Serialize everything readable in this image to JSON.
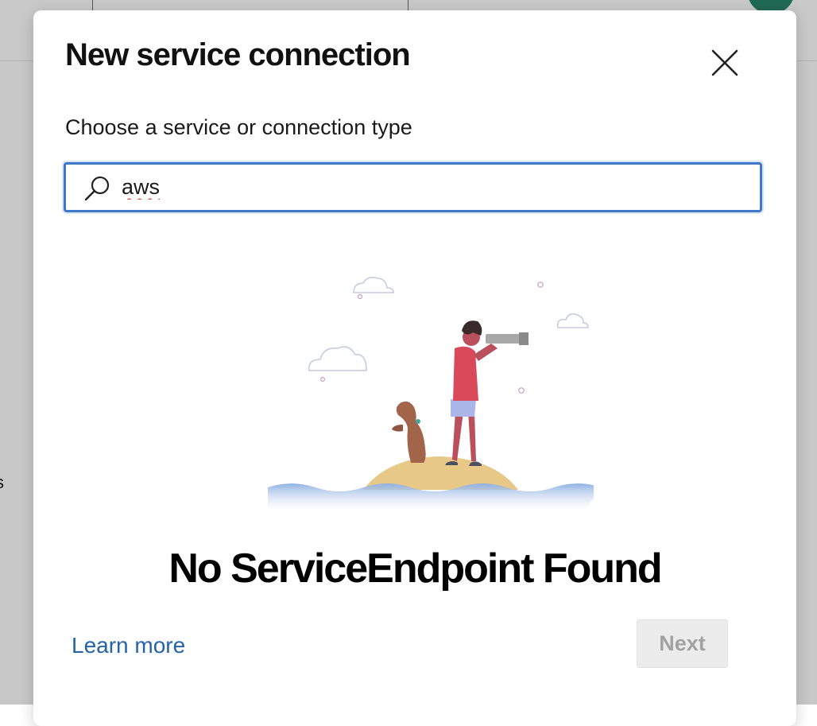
{
  "background": {
    "fragment_text": "s"
  },
  "dialog": {
    "title": "New service connection",
    "close_icon": "close-icon",
    "subtitle": "Choose a service or connection type",
    "search": {
      "icon": "search-icon",
      "value": "aws"
    },
    "empty_state": {
      "illustration": "explorer-with-dog-on-island",
      "message": "No ServiceEndpoint Found"
    },
    "footer": {
      "learn_more_label": "Learn more",
      "next_label": "Next",
      "next_disabled": true
    }
  },
  "colors": {
    "accent": "#3f78c8",
    "link": "#2463a8",
    "disabled_button_bg": "#ececec",
    "disabled_button_text": "#a2a2a2",
    "spellcheck_underline": "#e0584b"
  }
}
